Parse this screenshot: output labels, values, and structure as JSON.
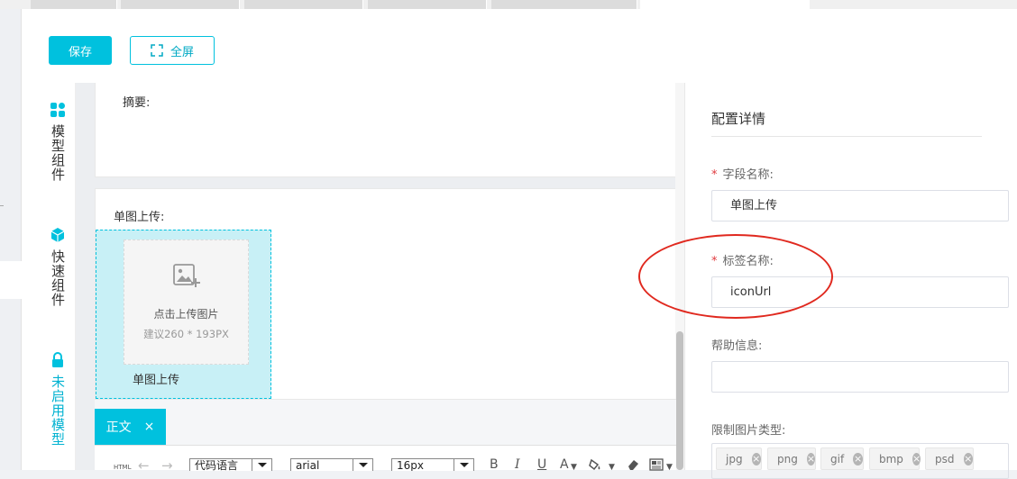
{
  "toolbar": {
    "save_label": "保存",
    "fullscreen_label": "全屏"
  },
  "side_tabs": [
    {
      "label": "模型组件",
      "icon": "grid-icon"
    },
    {
      "label": "快速组件",
      "icon": "cube-icon"
    },
    {
      "label": "未启用模型",
      "icon": "lock-icon"
    }
  ],
  "canvas": {
    "abstract_label": "摘要:",
    "upload_label": "单图上传:",
    "upload_hint": "点击上传图片",
    "upload_size_hint": "建议260 * 193PX",
    "upload_caption": "单图上传"
  },
  "editor": {
    "tab_label": "正文",
    "tab_close": "×",
    "html_label": "HTML",
    "code_select": "代码语言",
    "font_select": "arial",
    "size_select": "16px",
    "bold": "B",
    "italic": "I",
    "underline": "U",
    "font_color": "A"
  },
  "config": {
    "title": "配置详情",
    "field_name_label": "字段名称:",
    "field_name_value": "单图上传",
    "tag_name_label": "标签名称:",
    "tag_name_value": "iconUrl",
    "help_label": "帮助信息:",
    "help_value": "",
    "image_types_label": "限制图片类型:",
    "image_types": [
      "jpg",
      "png",
      "gif",
      "bmp",
      "psd"
    ],
    "required_mark": "*"
  },
  "colors": {
    "accent": "#00c1de",
    "annotation": "#e0291f",
    "required": "#e0393e"
  }
}
